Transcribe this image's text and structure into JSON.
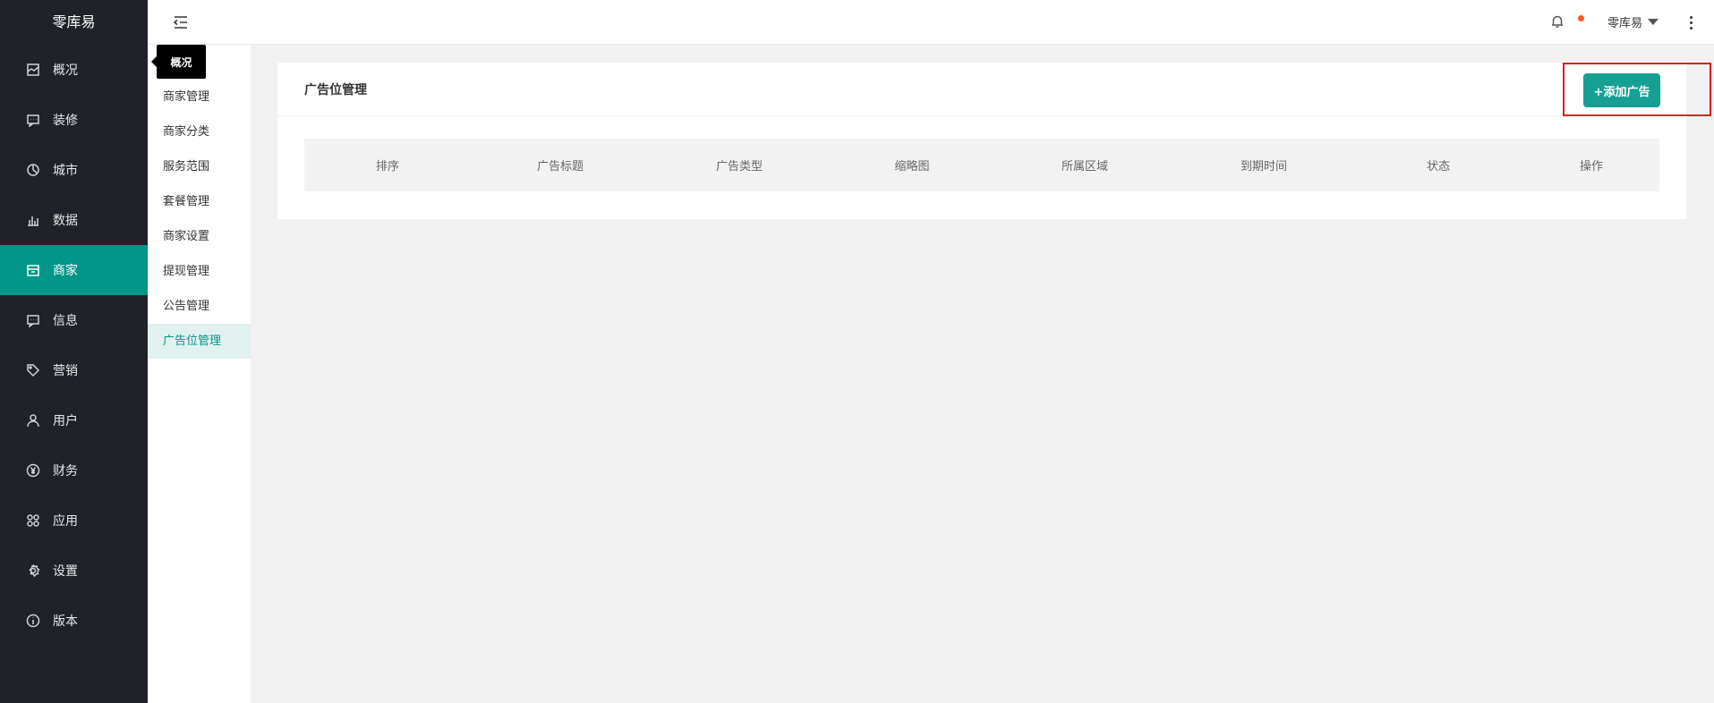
{
  "sidebar": {
    "brand": "零库易",
    "items": [
      {
        "label": "概况",
        "icon": "overview-icon"
      },
      {
        "label": "装修",
        "icon": "chat-icon"
      },
      {
        "label": "城市",
        "icon": "city-icon"
      },
      {
        "label": "数据",
        "icon": "chart-icon"
      },
      {
        "label": "商家",
        "icon": "shop-icon"
      },
      {
        "label": "信息",
        "icon": "message-icon"
      },
      {
        "label": "营销",
        "icon": "tag-icon"
      },
      {
        "label": "用户",
        "icon": "user-icon"
      },
      {
        "label": "财务",
        "icon": "yen-icon"
      },
      {
        "label": "应用",
        "icon": "apps-icon"
      },
      {
        "label": "设置",
        "icon": "gear-icon"
      },
      {
        "label": "版本",
        "icon": "info-icon"
      }
    ],
    "active": "商家"
  },
  "submenu": {
    "items": [
      "商家管理",
      "商家分类",
      "服务范围",
      "套餐管理",
      "商家设置",
      "提现管理",
      "公告管理",
      "广告位管理"
    ],
    "active": "广告位管理"
  },
  "tooltip": {
    "label": "概况"
  },
  "header": {
    "username": "零库易",
    "notification_dot_color": "#ff5722"
  },
  "card": {
    "title": "广告位管理",
    "add_button": "+添加广告",
    "columns": [
      "排序",
      "广告标题",
      "广告类型",
      "缩略图",
      "所属区域",
      "到期时间",
      "状态",
      "操作"
    ]
  },
  "colors": {
    "sidebar_bg": "#20222a",
    "accent": "#009688",
    "button": "#16a094",
    "highlight": "#e4161b"
  }
}
